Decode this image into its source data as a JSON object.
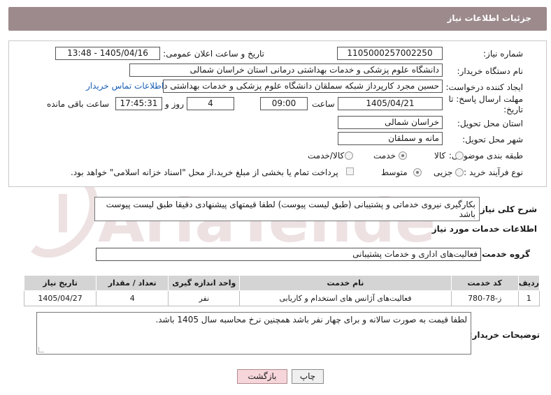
{
  "header": {
    "title": "جزئیات اطلاعات نیاز"
  },
  "form": {
    "need_number_label": "شماره نیاز:",
    "need_number": "1105000257002250",
    "announce_label": "تاریخ و ساعت اعلان عمومی:",
    "announce_value": "1405/04/16 - 13:48",
    "buyer_org_label": "نام دستگاه خریدار:",
    "buyer_org": "دانشگاه علوم پزشکی و خدمات بهداشتی درمانی استان خراسان شمالی",
    "requester_label": "ایجاد کننده درخواست:",
    "requester": "حسین مجرد کارپرداز شبکه سملقان دانشگاه علوم پزشکی و خدمات بهداشتی د",
    "contact_link": "اطلاعات تماس خریدار",
    "deadline_label_1": "مهلت ارسال پاسخ: تا",
    "deadline_label_2": "تاریخ:",
    "deadline_date": "1405/04/21",
    "time_label": "ساعت",
    "deadline_time": "09:00",
    "days_value": "4",
    "days_label": "روز و",
    "remaining_time": "17:45:31",
    "remaining_label": "ساعت باقی مانده",
    "province_label": "استان محل تحویل:",
    "province": "خراسان شمالی",
    "city_label": "شهر محل تحویل:",
    "city": "مانه و سملقان",
    "category_label": "طبقه بندی موضوعی:",
    "category_options": [
      "کالا",
      "خدمت",
      "کالا/خدمت"
    ],
    "category_selected": "خدمت",
    "process_label": "نوع فرآیند خرید :",
    "process_options": [
      "جزیی",
      "متوسط"
    ],
    "process_selected": "جزیی",
    "payment_note": "پرداخت تمام یا بخشی از مبلغ خرید،از محل \"اسناد خزانه اسلامی\" خواهد بود."
  },
  "description": {
    "label": "شرح کلی نیاز:",
    "text": "بکارگیری نیروی خدماتی و پشتیبانی (طبق لیست پیوست) لطفا قیمتهای پیشنهادی دقیقا طبق لیست پیوست باشد"
  },
  "services": {
    "section_title": "اطلاعات خدمات مورد نیاز",
    "group_label": "گروه خدمت:",
    "group_value": "فعالیت‌های اداری و خدمات پشتیبانی",
    "columns": [
      "ردیف",
      "کد خدمت",
      "نام خدمت",
      "واحد اندازه گیری",
      "تعداد / مقدار",
      "تاریخ نیاز"
    ],
    "rows": [
      [
        "1",
        "ز-78-780",
        "فعالیت‌های آژانس های استخدام و کاریابی",
        "نفر",
        "4",
        "1405/04/27"
      ]
    ]
  },
  "buyer_notes": {
    "label": "توضیحات خریدار:",
    "text": "لطفا قیمت به صورت سالانه و برای چهار نفر باشد همچنین نرخ محاسبه سال 1405  باشد."
  },
  "buttons": {
    "print": "چاپ",
    "back": "بازگشت"
  },
  "colors": {
    "header_bg": "#9c8a8c",
    "back_button_bg": "#f6d6da",
    "link": "#1a5fb4"
  },
  "icons": {
    "watermark": "aria-tender-watermark-logo"
  }
}
